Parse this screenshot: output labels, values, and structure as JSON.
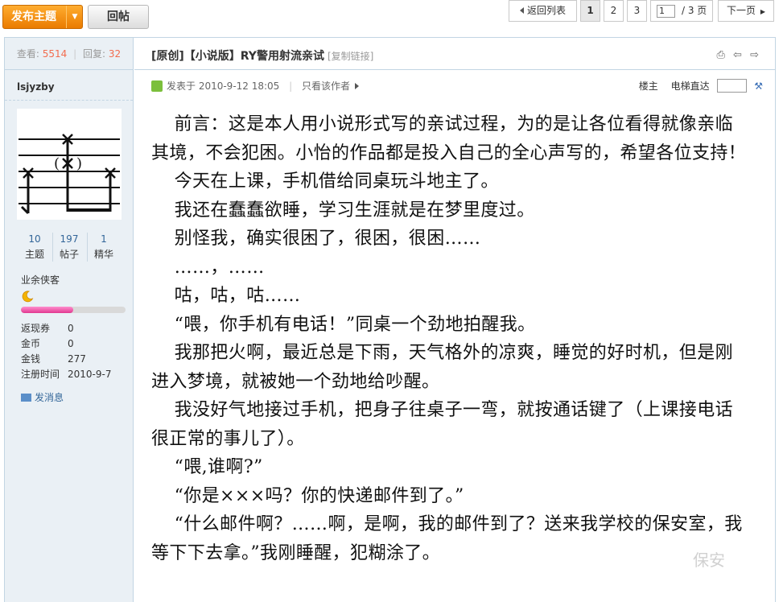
{
  "toolbar": {
    "new_thread": "发布主题",
    "reply": "回帖"
  },
  "pager": {
    "back": "返回列表",
    "pages": [
      "1",
      "2",
      "3"
    ],
    "current_page": "1",
    "input_value": "1",
    "total": "/ 3 页",
    "next": "下一页"
  },
  "sidebar": {
    "views_label": "查看:",
    "views": "5514",
    "replies_label": "回复:",
    "replies": "32",
    "author": "lsjyzby",
    "counts": [
      {
        "value": "10",
        "label": "主题"
      },
      {
        "value": "197",
        "label": "帖子"
      },
      {
        "value": "1",
        "label": "精华"
      }
    ],
    "rank": "业余侠客",
    "rank_progress": 0.5,
    "profile": [
      {
        "key": "返现券",
        "value": "0"
      },
      {
        "key": "金币",
        "value": "0"
      },
      {
        "key": "金钱",
        "value": "277"
      },
      {
        "key": "注册时间",
        "value": "2010-9-7"
      }
    ],
    "send_message": "发消息"
  },
  "post": {
    "title": "[原创]【小说版】RY警用射流亲试",
    "copy_link": "[复制链接]",
    "posted_at": "发表于 2010-9-12 18:05",
    "only_author": "只看该作者",
    "floor": "楼主",
    "jump_label": "电梯直达",
    "paragraphs": [
      "前言：这是本人用小说形式写的亲试过程，为的是让各位看得就像亲临其境，不会犯困。小怡的作品都是投入自己的全心声写的，希望各位支持！",
      "今天在上课，手机借给同桌玩斗地主了。",
      "我还在蠢蠢欲睡，学习生涯就是在梦里度过。",
      "别怪我，确实很困了，很困，很困……",
      "……，……",
      "咕，咕，咕……",
      "“喂，你手机有电话！”同桌一个劲地拍醒我。",
      "我那把火啊，最近总是下雨，天气格外的凉爽，睡觉的好时机，但是刚进入梦境，就被她一个劲地给吵醒。",
      "我没好气地接过手机，把身子往桌子一弯，就按通话键了（上课接电话很正常的事儿了）。",
      "“喂,谁啊?”",
      "“你是×××吗？你的快递邮件到了。”",
      "“什么邮件啊？……啊，是啊，我的邮件到了？送来我学校的保安室，我等下下去拿。”我刚睡醒，犯糊涂了。"
    ],
    "watermark": "保安"
  },
  "colors": {
    "accent_orange": "#ea7b00",
    "border_blue": "#c2d5e3",
    "sidebar_bg": "#eaf0f5",
    "stat_red": "#f26c4f",
    "link_blue": "#336699"
  }
}
